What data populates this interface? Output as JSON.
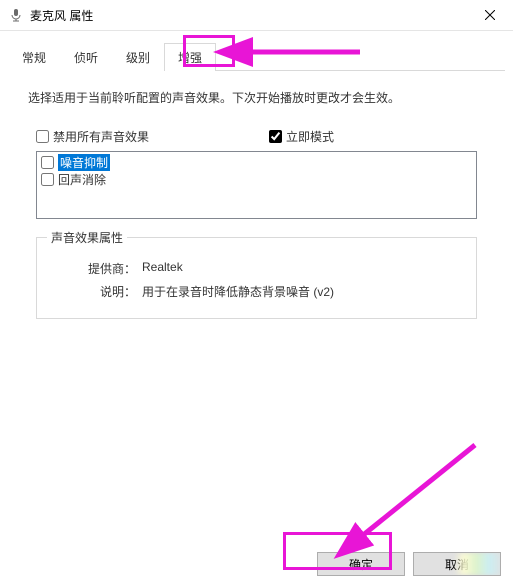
{
  "window": {
    "title": "麦克风 属性",
    "close_icon": "×"
  },
  "tabs": [
    {
      "label": "常规"
    },
    {
      "label": "侦听"
    },
    {
      "label": "级别"
    },
    {
      "label": "增强",
      "active": true
    }
  ],
  "description": "选择适用于当前聆听配置的声音效果。下次开始播放时更改才会生效。",
  "checkboxes": {
    "disable_all": {
      "label": "禁用所有声音效果",
      "checked": false
    },
    "immediate_mode": {
      "label": "立即模式",
      "checked": true
    }
  },
  "effects_list": [
    {
      "label": "噪音抑制",
      "checked": false,
      "selected": true
    },
    {
      "label": "回声消除",
      "checked": false,
      "selected": false
    }
  ],
  "properties_group": {
    "legend": "声音效果属性",
    "rows": [
      {
        "key": "提供商：",
        "value": "Realtek"
      },
      {
        "key": "说明：",
        "value": "用于在录音时降低静态背景噪音 (v2)"
      }
    ]
  },
  "buttons": {
    "ok": "确定",
    "cancel": "取消"
  },
  "annotations": {
    "arrow_color": "#e815d6"
  }
}
